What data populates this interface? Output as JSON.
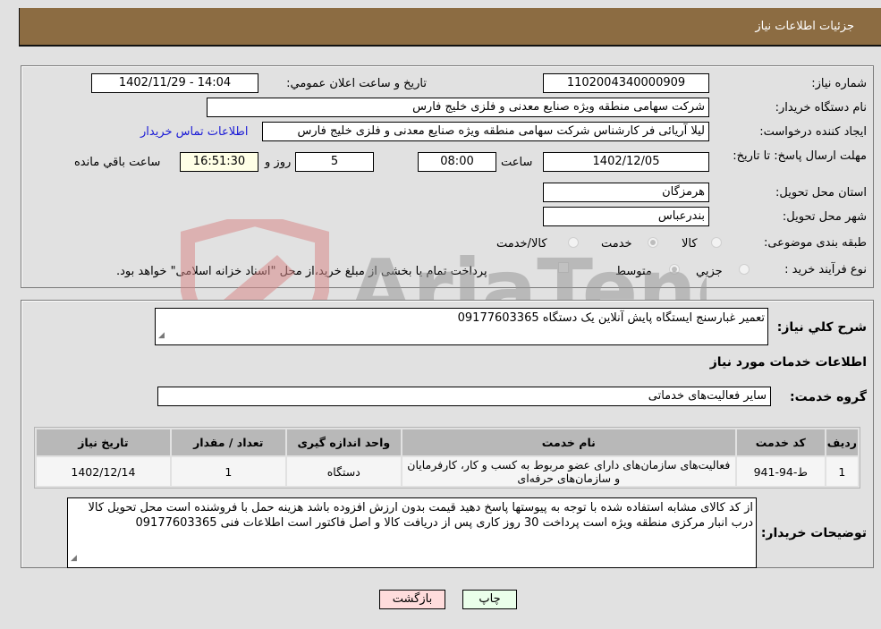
{
  "header": {
    "title": "جزئیات اطلاعات نیاز"
  },
  "form": {
    "need_number": {
      "label": "شماره نیاز:",
      "value": "1102004340000909"
    },
    "announce_datetime": {
      "label": "تاریخ و ساعت اعلان عمومي:",
      "value": "1402/11/29 - 14:04"
    },
    "buyer_org": {
      "label": "نام دستگاه خریدار:",
      "value": "شرکت سهامی منطقه ویژه صنایع معدنی و فلزی خلیج فارس"
    },
    "requester": {
      "label": "ایجاد کننده درخواست:",
      "value": "لیلا آریائی فر کارشناس شرکت سهامی منطقه ویژه صنایع معدنی و فلزی خلیج فارس",
      "contact_link": "اطلاعات تماس خریدار"
    },
    "deadline": {
      "label": "مهلت ارسال پاسخ: تا تاریخ:",
      "date": "1402/12/05",
      "time_label": "ساعت",
      "time": "08:00",
      "days": "5",
      "days_label": "روز و",
      "remaining": "16:51:30",
      "remaining_label": "ساعت باقي مانده"
    },
    "province": {
      "label": "استان محل تحویل:",
      "value": "هرمزگان"
    },
    "city": {
      "label": "شهر محل تحویل:",
      "value": "بندرعباس"
    },
    "category": {
      "label": "طبقه بندی موضوعی:",
      "options": [
        {
          "label": "کالا",
          "selected": false
        },
        {
          "label": "خدمت",
          "selected": true
        },
        {
          "label": "کالا/خدمت",
          "selected": false
        }
      ]
    },
    "purchase_type": {
      "label": "نوع فرآیند خرید :",
      "options": [
        {
          "label": "جزيي",
          "selected": false
        },
        {
          "label": "متوسط",
          "selected": true
        }
      ],
      "treasury_note": "پرداخت تمام یا بخشی از مبلغ خرید،از محل \"اسناد خزانه اسلامی\" خواهد بود.",
      "treasury_checked": false
    }
  },
  "details": {
    "summary_label": "شرح کلي نیاز:",
    "summary_value": "تعمیر غبارسنج ایستگاه پایش آنلاین یک دستگاه 09177603365",
    "services_heading": "اطلاعات خدمات مورد نیاز",
    "service_group_label": "گروه خدمت:",
    "service_group_value": "سایر فعالیت‌های خدماتی",
    "table": {
      "headers": [
        "ردیف",
        "کد خدمت",
        "نام خدمت",
        "واحد اندازه گیری",
        "تعداد / مقدار",
        "تاریخ نیاز"
      ],
      "rows": [
        [
          "1",
          "ط-94-941",
          "فعالیت‌های سازمان‌های دارای عضو مربوط به کسب و کار، کارفرمایان و سازمان‌های حرفه‌ای",
          "دستگاه",
          "1",
          "1402/12/14"
        ]
      ]
    },
    "buyer_notes_label": "توضیحات خریدار:",
    "buyer_notes_value": "از کد کالای مشابه استفاده شده با توجه به پیوستها پاسخ دهید قیمت بدون ارزش افزوده باشد هزینه حمل با فروشنده است محل تحویل کالا درب انبار مرکزی منطقه ویژه است پرداخت 30 روز کاری پس از دریافت کالا و اصل فاکتور است اطلاعات فنی 09177603365"
  },
  "buttons": {
    "print": "چاپ",
    "back": "بازگشت"
  },
  "watermark": {
    "text": "AriaTender.neT"
  },
  "colors": {
    "header_bg": "#8c6c42",
    "print_bg": "#eaffea",
    "back_bg": "#ffdcdc",
    "link": "#1a1ad6"
  }
}
